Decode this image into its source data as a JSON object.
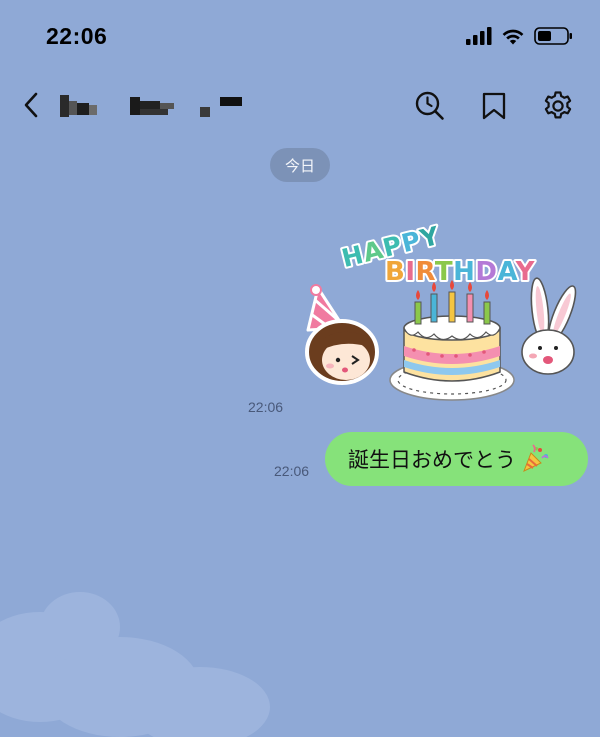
{
  "status_bar": {
    "time": "22:06",
    "icons": [
      "cellular-signal-icon",
      "wifi-icon",
      "battery-icon"
    ]
  },
  "header": {
    "back_icon": "chevron-left-icon",
    "title_obscured": true,
    "actions": [
      "search-icon",
      "bookmark-icon",
      "gear-icon"
    ]
  },
  "chat": {
    "date_divider": "今日",
    "messages": [
      {
        "type": "sticker",
        "direction": "outgoing",
        "time": "22:06",
        "sticker_text_top": "HAPPY",
        "sticker_text_bottom": "BIRTHDAY"
      },
      {
        "type": "text",
        "direction": "outgoing",
        "time": "22:06",
        "text": "誕生日おめでとう",
        "emoji": "party-popper-icon"
      }
    ]
  },
  "colors": {
    "background": "#8fa9d6",
    "bubble_outgoing": "#86e27a",
    "date_pill": "#6e809e",
    "time_text": "#49597a"
  }
}
